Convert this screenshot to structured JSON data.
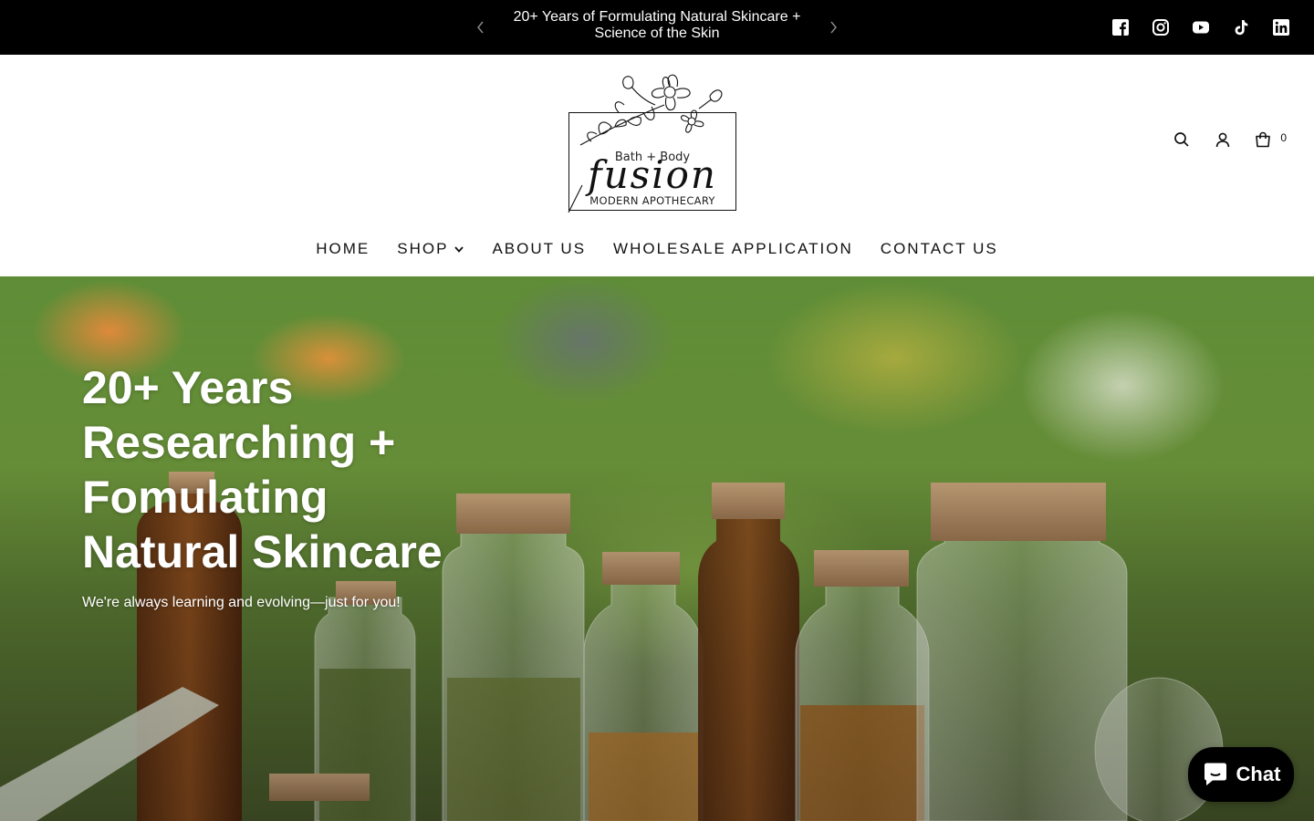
{
  "announcement": {
    "message": "20+ Years of Formulating Natural Skincare + Science of the Skin",
    "prev_icon": "chevron-left-icon",
    "next_icon": "chevron-right-icon"
  },
  "socials": [
    {
      "name": "facebook-icon"
    },
    {
      "name": "instagram-icon"
    },
    {
      "name": "youtube-icon"
    },
    {
      "name": "tiktok-icon"
    },
    {
      "name": "linkedin-icon"
    }
  ],
  "logo": {
    "line1": "Bath + Body",
    "line2": "fusion",
    "line3": "MODERN APOTHECARY"
  },
  "header_icons": {
    "search": "search-icon",
    "account": "account-icon",
    "cart": "cart-icon",
    "cart_count": "0"
  },
  "nav": {
    "items": [
      {
        "label": "HOME"
      },
      {
        "label": "SHOP",
        "has_dropdown": true
      },
      {
        "label": "ABOUT US"
      },
      {
        "label": "WHOLESALE APPLICATION"
      },
      {
        "label": "CONTACT US"
      }
    ]
  },
  "hero": {
    "title": "20+ Years Researching + Fomulating Natural Skincare",
    "subtitle": "We're always learning and evolving—just for you!"
  },
  "chat": {
    "label": "Chat",
    "icon": "chat-bubble-icon"
  },
  "colors": {
    "announcement_bg": "#000000",
    "header_bg": "#ffffff",
    "text": "#111111",
    "hero_text": "#ffffff",
    "chat_bg": "#000000"
  }
}
